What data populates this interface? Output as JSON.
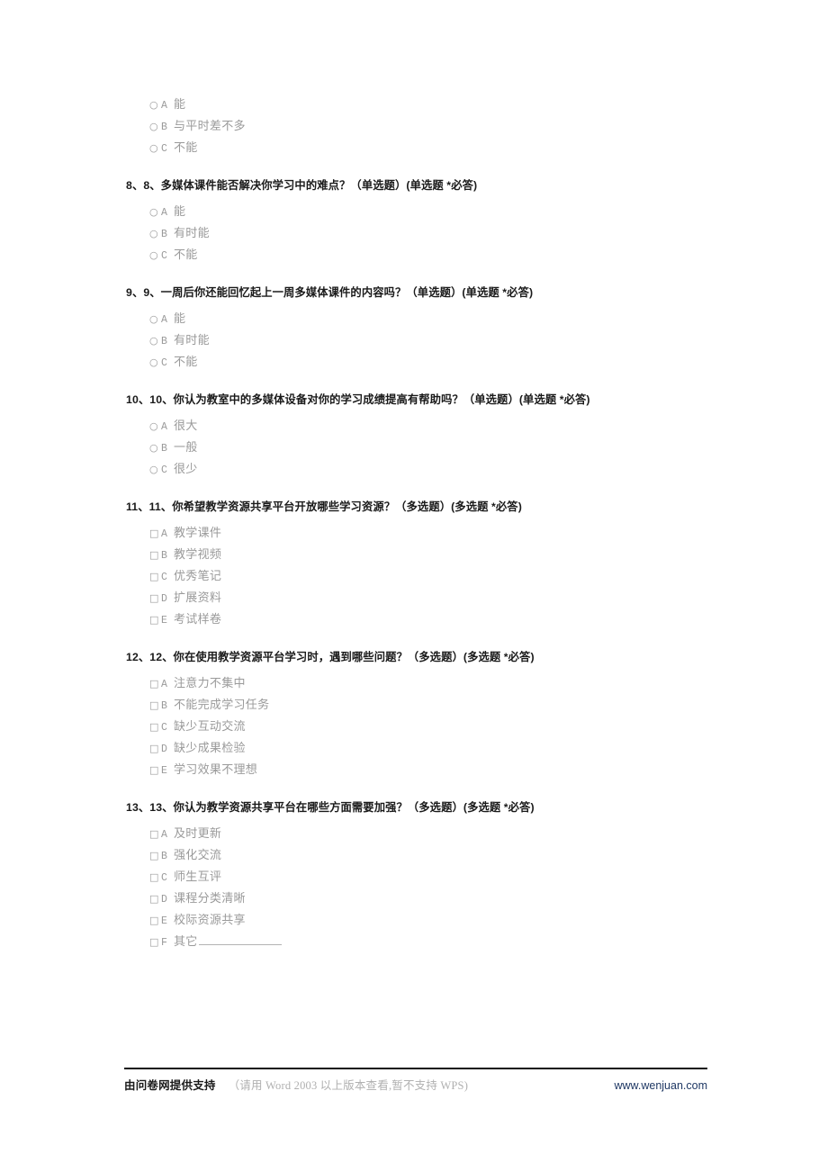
{
  "document": {
    "type": "survey-questionnaire",
    "language": "zh-CN"
  },
  "orphan_options": {
    "note": "options continuing from the question on the previous page",
    "input_type": "radio",
    "items": [
      {
        "letter": "A",
        "label": "能"
      },
      {
        "letter": "B",
        "label": "与平时差不多"
      },
      {
        "letter": "C",
        "label": "不能"
      }
    ]
  },
  "questions": [
    {
      "number": "8",
      "title": "8、8、多媒体课件能否解决你学习中的难点？（单选题）(单选题 *必答)",
      "input_type": "radio",
      "options": [
        {
          "letter": "A",
          "label": "能"
        },
        {
          "letter": "B",
          "label": "有时能"
        },
        {
          "letter": "C",
          "label": "不能"
        }
      ]
    },
    {
      "number": "9",
      "title": "9、9、一周后你还能回忆起上一周多媒体课件的内容吗？（单选题）(单选题 *必答)",
      "input_type": "radio",
      "options": [
        {
          "letter": "A",
          "label": "能"
        },
        {
          "letter": "B",
          "label": "有时能"
        },
        {
          "letter": "C",
          "label": "不能"
        }
      ]
    },
    {
      "number": "10",
      "title": "10、10、你认为教室中的多媒体设备对你的学习成绩提高有帮助吗？（单选题）(单选题 *必答)",
      "input_type": "radio",
      "options": [
        {
          "letter": "A",
          "label": "很大"
        },
        {
          "letter": "B",
          "label": "一般"
        },
        {
          "letter": "C",
          "label": "很少"
        }
      ]
    },
    {
      "number": "11",
      "title": "11、11、你希望教学资源共享平台开放哪些学习资源？（多选题）(多选题 *必答)",
      "input_type": "checkbox",
      "options": [
        {
          "letter": "A",
          "label": "教学课件"
        },
        {
          "letter": "B",
          "label": "教学视频"
        },
        {
          "letter": "C",
          "label": "优秀笔记"
        },
        {
          "letter": "D",
          "label": "扩展资料"
        },
        {
          "letter": "E",
          "label": "考试样卷"
        }
      ]
    },
    {
      "number": "12",
      "title": "12、12、你在使用教学资源平台学习时，遇到哪些问题？（多选题）(多选题 *必答)",
      "input_type": "checkbox",
      "options": [
        {
          "letter": "A",
          "label": "注意力不集中"
        },
        {
          "letter": "B",
          "label": "不能完成学习任务"
        },
        {
          "letter": "C",
          "label": "缺少互动交流"
        },
        {
          "letter": "D",
          "label": "缺少成果检验"
        },
        {
          "letter": "E",
          "label": "学习效果不理想"
        }
      ]
    },
    {
      "number": "13",
      "title": "13、13、你认为教学资源共享平台在哪些方面需要加强？（多选题）(多选题 *必答)",
      "input_type": "checkbox",
      "options": [
        {
          "letter": "A",
          "label": "及时更新"
        },
        {
          "letter": "B",
          "label": "强化交流"
        },
        {
          "letter": "C",
          "label": "师生互评"
        },
        {
          "letter": "D",
          "label": "课程分类清晰"
        },
        {
          "letter": "E",
          "label": "校际资源共享"
        },
        {
          "letter": "F",
          "label": "其它",
          "has_blank": true
        }
      ]
    }
  ],
  "glyphs": {
    "radio": "○",
    "checkbox": "□"
  },
  "footer": {
    "brand": "由问卷网提供支持",
    "note": "（请用 Word 2003 以上版本查看,暂不支持 WPS)",
    "link": "www.wenjuan.com",
    "link_color": "#1f3864"
  }
}
